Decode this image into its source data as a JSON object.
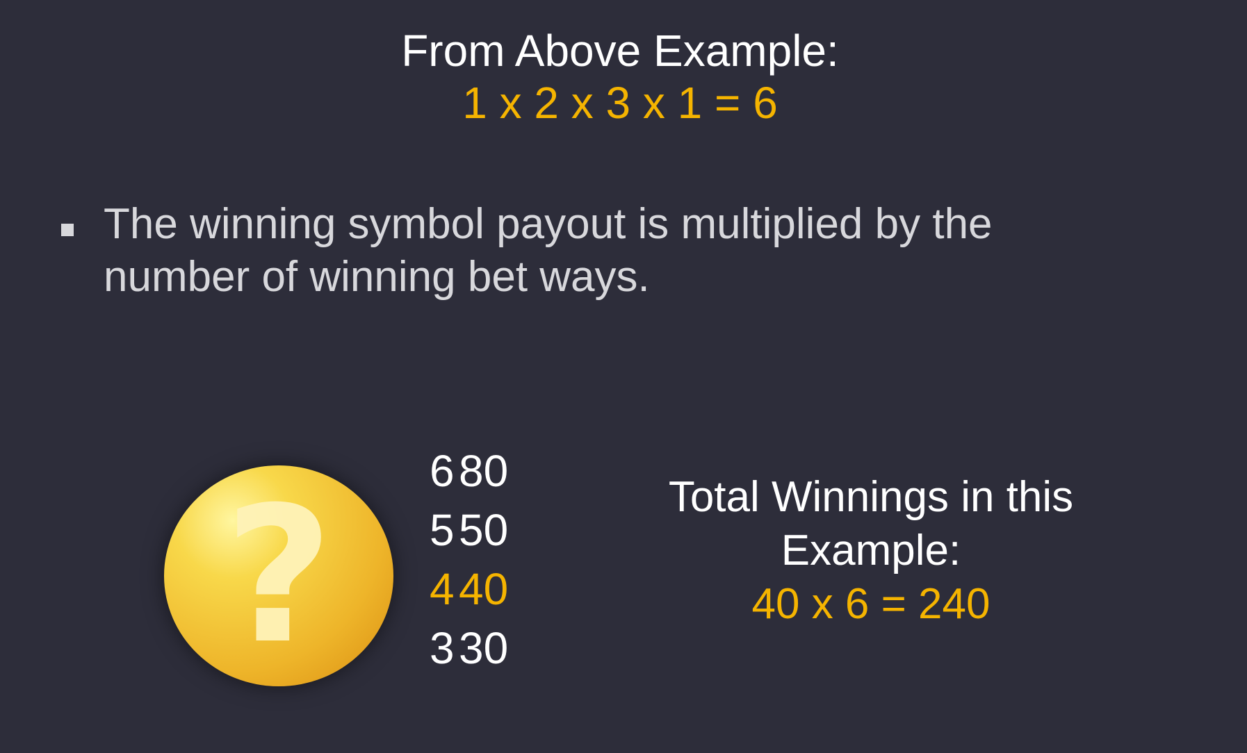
{
  "example": {
    "heading": "From Above Example:",
    "formula": "1 x 2 x 3 x 1 = 6"
  },
  "rule": {
    "text": "The winning symbol payout is multiplied by the number of winning bet ways."
  },
  "symbol": {
    "icon": "question-mark-coin-icon",
    "paytable": [
      {
        "count": "6",
        "payout": "80",
        "highlighted": false
      },
      {
        "count": "5",
        "payout": "50",
        "highlighted": false
      },
      {
        "count": "4",
        "payout": "40",
        "highlighted": true
      },
      {
        "count": "3",
        "payout": "30",
        "highlighted": false
      }
    ]
  },
  "total": {
    "label": "Total Winnings in this Example:",
    "formula": "40 x 6 = 240"
  },
  "colors": {
    "background": "#2d2d3a",
    "accent": "#f5b400",
    "text": "#ffffff"
  }
}
